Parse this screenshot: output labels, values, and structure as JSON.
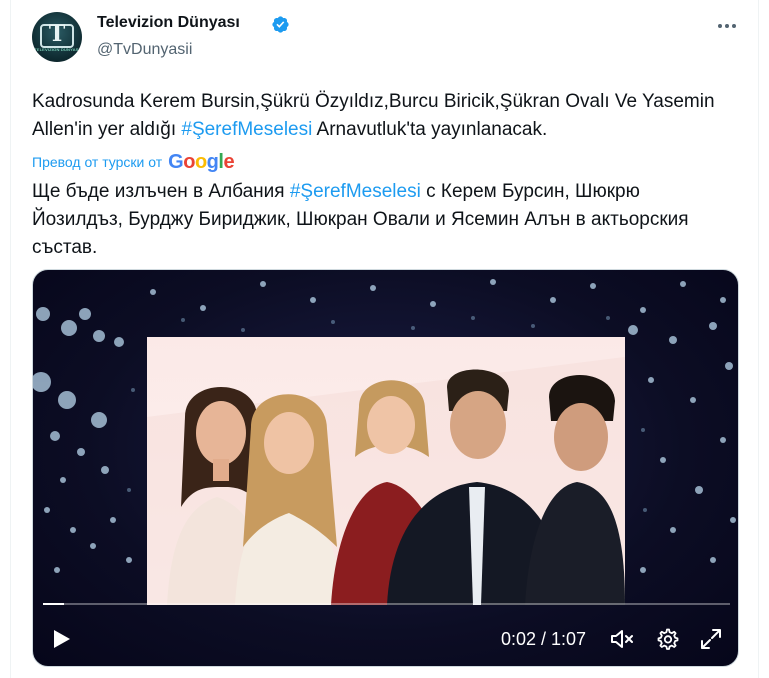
{
  "author": {
    "name": "Televizion Dünyası",
    "handle": "@TvDunyasii",
    "avatar_text": "T",
    "avatar_subtext": "TELEVIZION DUNYASI"
  },
  "tweet": {
    "text_part1": "Kadrosunda Kerem Bursin,Şükrü Özyıldız,Burcu Biricik,Şükran Ovalı Ve Yasemin Allen'in yer aldığı ",
    "hashtag": "#ŞerefMeselesi",
    "text_part2": " Arnavutluk'ta yayınlanacak."
  },
  "translation": {
    "label": "Превод от турски от",
    "provider": "Google",
    "text_part1": "Ще бъде излъчен в Албания ",
    "hashtag": "#ŞerefMeselesi",
    "text_part2": " с Керем Бурсин, Шюкрю Йозилдъз, Бурджу Бириджик, Шюкран Овали и Ясемин Алън в актьорския състав."
  },
  "video": {
    "current_time": "0:02",
    "duration": "1:07",
    "time_label": "0:02 / 1:07",
    "progress": 0.03
  },
  "icons": {
    "verified": "verified-badge-icon",
    "more": "more-horizontal-icon",
    "play": "play-icon",
    "mute": "volume-muted-icon",
    "settings": "settings-gear-icon",
    "fullscreen": "fullscreen-icon"
  },
  "colors": {
    "accent": "#1d9bf0",
    "text": "#0f1419",
    "secondary": "#536471"
  }
}
